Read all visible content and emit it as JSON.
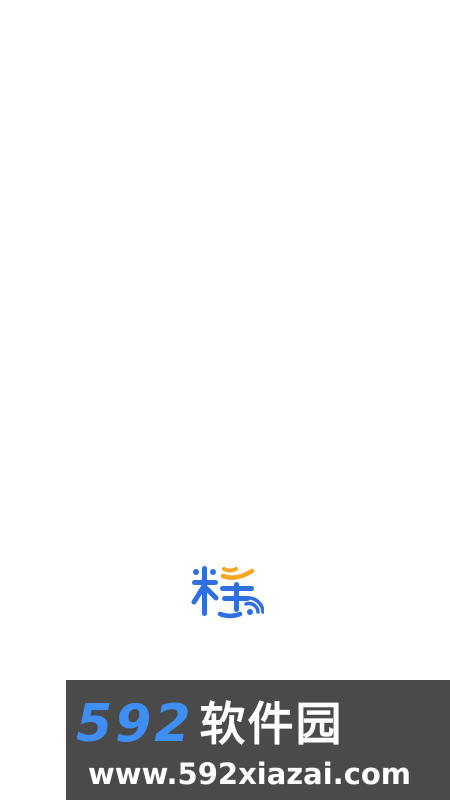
{
  "splash": {
    "logo": {
      "icon": "app-logo-icon",
      "char": "糕",
      "colors": {
        "blue": "#2f6fe0",
        "orange": "#f5a623"
      }
    }
  },
  "watermark": {
    "title_number": "592",
    "title_text": "软件园",
    "url": "www.592xiazai.com",
    "colors": {
      "background": "#4a4a4a",
      "number": "#3f8ef2",
      "text": "#ffffff"
    }
  }
}
